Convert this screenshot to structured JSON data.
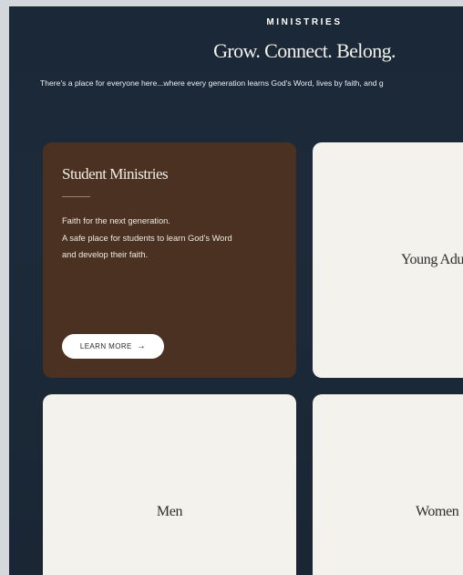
{
  "header": {
    "eyebrow": "MINISTRIES",
    "headline": "Grow. Connect. Belong.",
    "intro": "There's a place for everyone here...where every generation learns God's Word, lives by faith, and g"
  },
  "cards": [
    {
      "title": "Student Ministries",
      "description_lines": [
        "Faith for the next generation.",
        "A safe place for students to learn God's Word",
        "and develop their faith."
      ],
      "button_label": "LEARN MORE",
      "button_icon": "arrow-right-icon"
    },
    {
      "title": "Young Adu"
    },
    {
      "title": "Men"
    },
    {
      "title": "Women"
    }
  ],
  "colors": {
    "background": "#1b2838",
    "card_dark": "#4a3122",
    "card_light": "#f3f2ed",
    "outer": "#d4d7db"
  }
}
